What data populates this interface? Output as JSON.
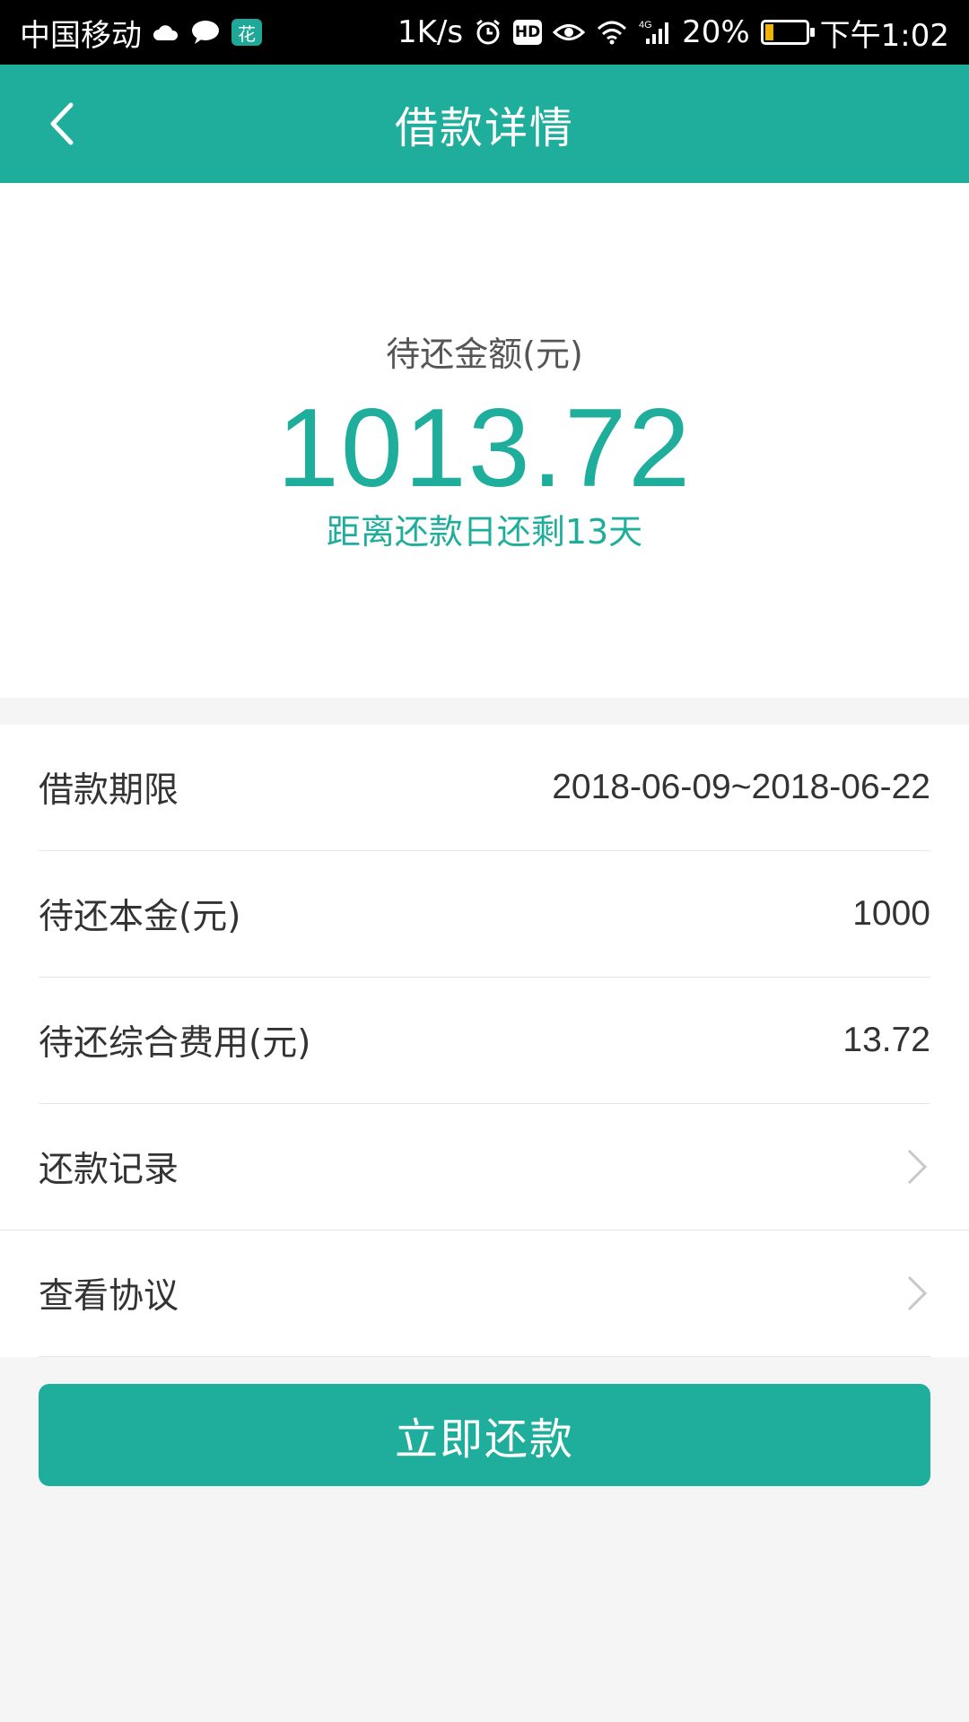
{
  "status_bar": {
    "carrier": "中国移动",
    "speed": "1K/s",
    "network": "4G",
    "battery": "20%",
    "time": "下午1:02",
    "icons": [
      "cloud-icon",
      "chat-icon",
      "app-badge-icon",
      "alarm-icon",
      "hd-icon",
      "eye-icon",
      "wifi-icon",
      "signal-icon",
      "battery-icon"
    ]
  },
  "nav": {
    "title": "借款详情",
    "back_icon": "chevron-left-icon"
  },
  "summary": {
    "label": "待还金额(元)",
    "amount": "1013.72",
    "countdown": "距离还款日还剩13天"
  },
  "details": [
    {
      "label": "借款期限",
      "value": "2018-06-09~2018-06-22"
    },
    {
      "label": "待还本金(元)",
      "value": "1000"
    },
    {
      "label": "待还综合费用(元)",
      "value": "13.72"
    },
    {
      "label": "还款记录",
      "value": "",
      "link": true
    },
    {
      "label": "查看协议",
      "value": "",
      "link": true
    }
  ],
  "repay_button": "立即还款",
  "colors": {
    "accent": "#1fae9c",
    "background": "#f5f5f5",
    "text": "#333333"
  }
}
